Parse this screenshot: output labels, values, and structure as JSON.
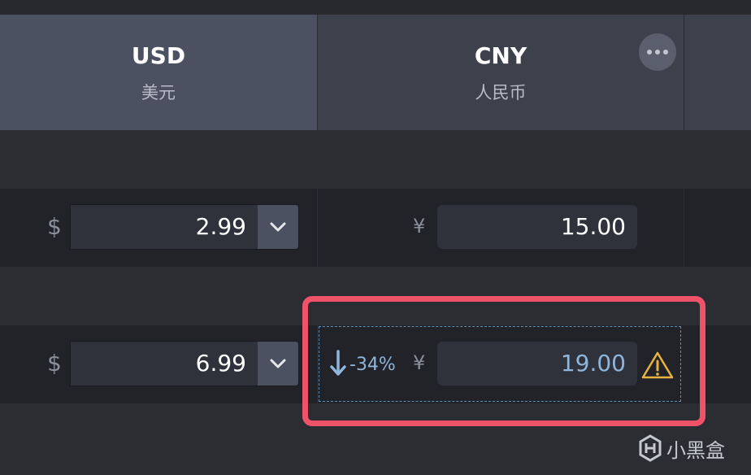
{
  "header": {
    "columns": [
      {
        "code": "USD",
        "name": "美元"
      },
      {
        "code": "CNY",
        "name": "人民币"
      }
    ],
    "more_icon": "more-horizontal-icon"
  },
  "rows": [
    {
      "usd_symbol": "$",
      "usd_value": "2.99",
      "cny_symbol": "¥",
      "cny_value": "15.00"
    },
    {
      "usd_symbol": "$",
      "usd_value": "6.99",
      "cny_symbol": "¥",
      "cny_value": "19.00",
      "change_percent": "-34%",
      "warning_icon": "warning-triangle-icon"
    }
  ],
  "watermark": {
    "text": "小黑盒"
  },
  "colors": {
    "header_usd": "#4b5161",
    "header_cny": "#3d414c",
    "highlight_border": "#f0526a",
    "accent_blue": "#8fb5da",
    "warning": "#e8b33c"
  }
}
